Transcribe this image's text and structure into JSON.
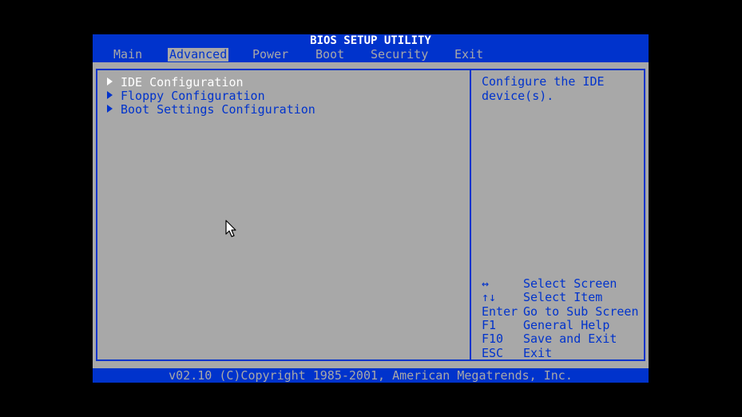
{
  "title": "BIOS SETUP UTILITY",
  "tabs": [
    {
      "label": "Main"
    },
    {
      "label": "Advanced"
    },
    {
      "label": "Power"
    },
    {
      "label": "Boot"
    },
    {
      "label": "Security"
    },
    {
      "label": "Exit"
    }
  ],
  "active_tab": "Advanced",
  "menu": [
    {
      "label": "IDE Configuration",
      "selected": true
    },
    {
      "label": "Floppy Configuration",
      "selected": false
    },
    {
      "label": "Boot Settings Configuration",
      "selected": false
    }
  ],
  "help_text": "Configure the IDE\ndevice(s).",
  "keys": [
    {
      "key": "↔",
      "action": "Select Screen"
    },
    {
      "key": "↑↓",
      "action": "Select Item"
    },
    {
      "key": "Enter",
      "action": "Go to Sub Screen"
    },
    {
      "key": "F1",
      "action": "General Help"
    },
    {
      "key": "F10",
      "action": "Save and Exit"
    },
    {
      "key": "ESC",
      "action": "Exit"
    }
  ],
  "footer": "v02.10 (C)Copyright 1985-2001, American Megatrends, Inc.",
  "colors": {
    "bios_blue": "#0033cc",
    "bios_gray": "#a8a8a8",
    "highlight_white": "#ffffff",
    "background": "#000000"
  },
  "icons": {
    "submenu": "triangle-right-icon",
    "pointer": "mouse-cursor-icon"
  }
}
